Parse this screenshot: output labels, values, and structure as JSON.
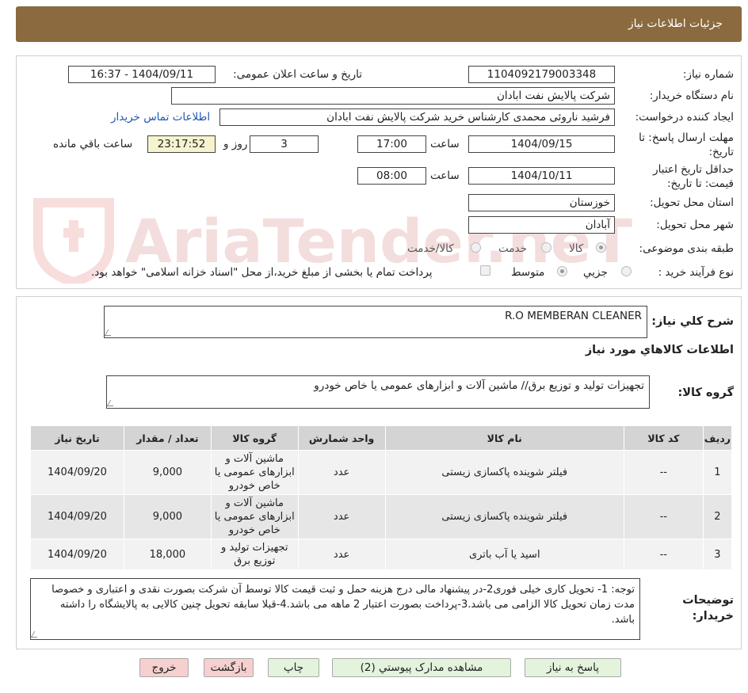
{
  "header": {
    "title": "جزئیات اطلاعات نیاز"
  },
  "form": {
    "need_number_label": "شماره نیاز:",
    "need_number": "1104092179003348",
    "announce_label": "تاریخ و ساعت اعلان عمومی:",
    "announce_value": "1404/09/11 - 16:37",
    "buyer_org_label": "نام دستگاه خریدار:",
    "buyer_org": "شرکت پالایش نفت ابادان",
    "requester_label": "ایجاد کننده درخواست:",
    "requester": "فرشید ناروئی محمدی کارشناس خرید  شرکت پالایش نفت ابادان",
    "contact_link": "اطلاعات تماس خریدار",
    "deadline_label": "مهلت ارسال پاسخ: تا تاریخ:",
    "deadline_date": "1404/09/15",
    "time_label": "ساعت",
    "deadline_time": "17:00",
    "days_value": "3",
    "days_label": "روز و",
    "remaining_time": "23:17:52",
    "remaining_label": "ساعت باقي مانده",
    "validity_label": "حداقل تاریخ اعتبار قیمت: تا تاریخ:",
    "validity_date": "1404/10/11",
    "validity_time": "08:00",
    "province_label": "استان محل تحویل:",
    "province": "خوزستان",
    "city_label": "شهر محل تحویل:",
    "city": "آبادان",
    "category_label": "طبقه بندی موضوعی:",
    "category_options": [
      "کالا",
      "خدمت",
      "کالا/خدمت"
    ],
    "process_label": "نوع فرآیند خرید :",
    "process_options": [
      "جزیي",
      "متوسط"
    ],
    "payment_note": "پرداخت تمام یا بخشی از مبلغ خرید،از محل \"اسناد خزانه اسلامی\" خواهد بود."
  },
  "description": {
    "label": "شرح کلي نياز:",
    "value": "R.O MEMBERAN CLEANER"
  },
  "goods_section": {
    "title": "اطلاعات کالاهاي مورد نياز",
    "group_label": "گروه کالا:",
    "group_value": "تجهیزات تولید و توزیع برق//  ماشین آلات و ابزارهای عمومی یا خاص خودرو"
  },
  "table": {
    "headers": [
      "رديف",
      "کد کالا",
      "نام کالا",
      "واحد شمارش",
      "گروه کالا",
      "تعداد / مقدار",
      "تاريخ نياز"
    ],
    "rows": [
      [
        "1",
        "--",
        "فیلتر شوینده پاکسازی زیستی",
        "عدد",
        "ماشین آلات و ابزارهای عمومی یا خاص خودرو",
        "9,000",
        "1404/09/20"
      ],
      [
        "2",
        "--",
        "فیلتر شوینده پاکسازی زیستی",
        "عدد",
        "ماشین آلات و ابزارهای عمومی یا خاص خودرو",
        "9,000",
        "1404/09/20"
      ],
      [
        "3",
        "--",
        "اسید یا آب باتری",
        "عدد",
        "تجهیزات تولید و توزیع برق",
        "18,000",
        "1404/09/20"
      ]
    ]
  },
  "notes": {
    "label": "توضیحات خریدار:",
    "value": "توجه: 1- تحویل کاری خیلی فوری2-در پیشنهاد مالی درج هزینه حمل و ثبت قیمت کالا توسط آن شرکت بصورت نقدی و اعتباری و خصوصا مدت زمان تحویل کالا الزامی می باشد.3-پرداخت بصورت اعتبار 2 ماهه می باشد.4-قبلا سابقه تحویل چنین کالایی به پالایشگاه را داشته باشد."
  },
  "buttons": {
    "reply": "پاسخ به نیاز",
    "attachments": "مشاهده مدارک پیوستي (2)",
    "print": "چاپ",
    "back": "بازگشت",
    "exit": "خروج"
  },
  "watermark": {
    "text": "AriaTender.neT"
  }
}
